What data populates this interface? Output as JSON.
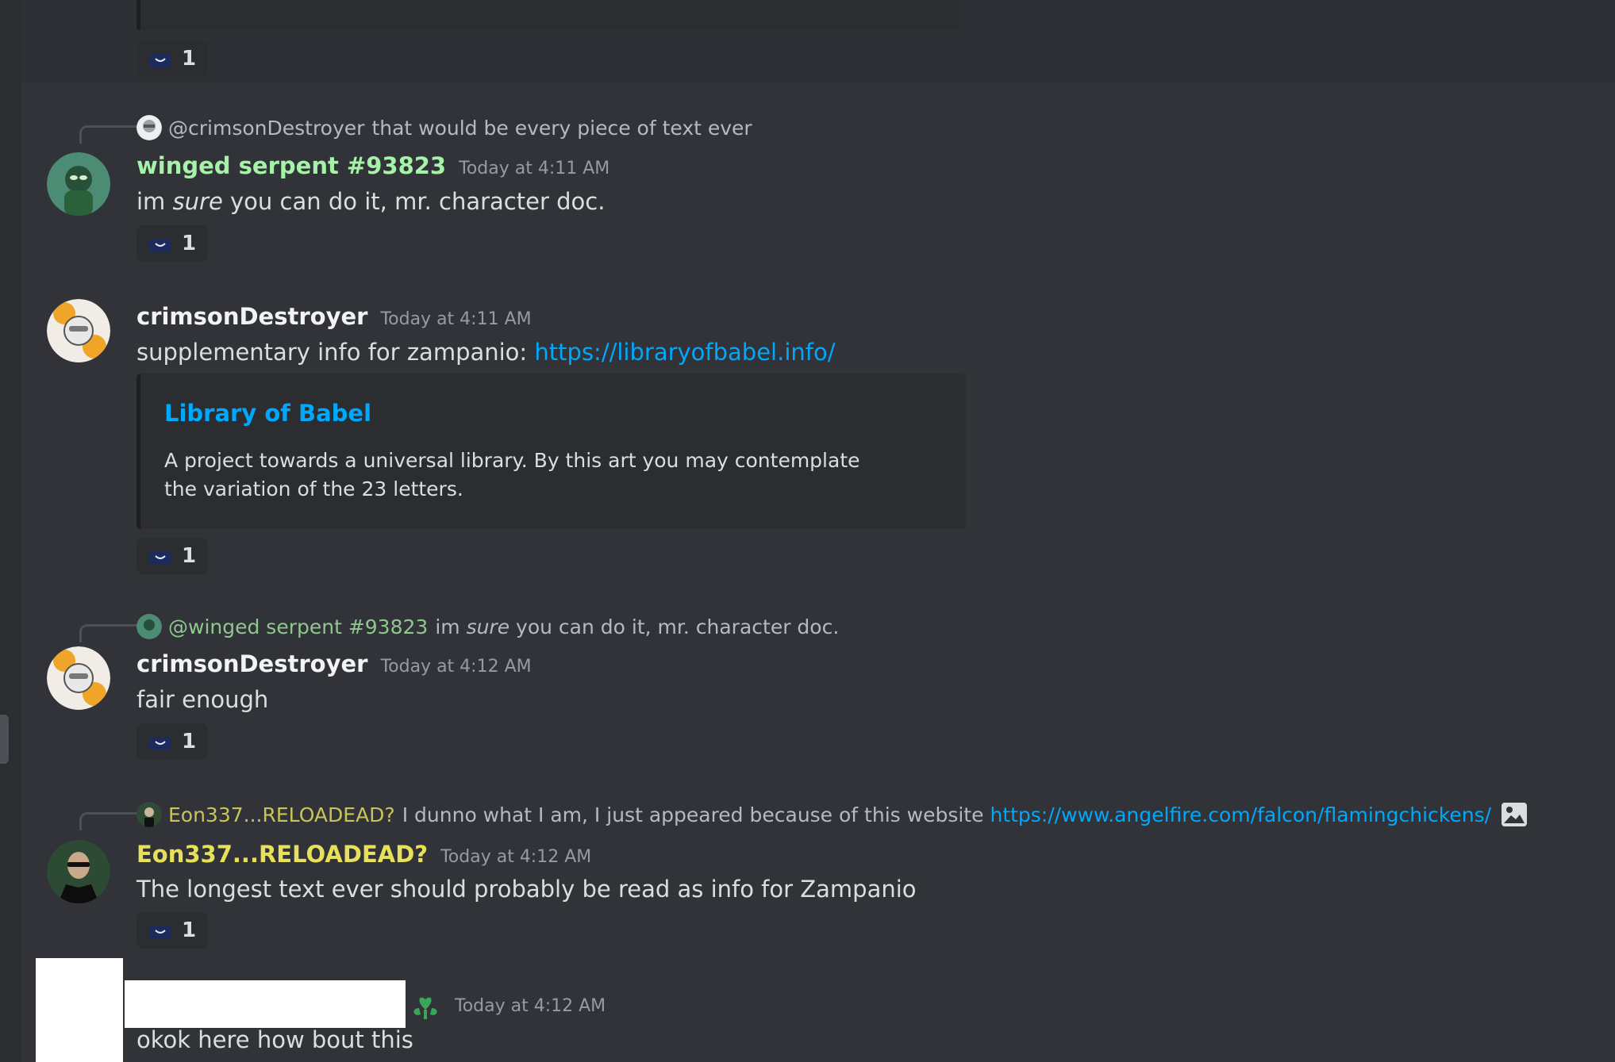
{
  "colors": {
    "background": "#313338",
    "green_user": "#a6f2a8",
    "crimson_user": "#f2f3f5",
    "eon_user": "#e6e05a",
    "link": "#00a8fc",
    "timestamp": "#949ba4",
    "reply_green": "#8fc78f"
  },
  "reaction_count": "1",
  "messages": {
    "m1": {
      "reply": {
        "name": "@crimsonDestroyer",
        "text": "that would be every piece of text ever"
      },
      "author": "winged serpent #93823",
      "timestamp": "Today at 4:11 AM",
      "text_pre": "im ",
      "text_em": "sure",
      "text_post": " you can do it, mr. character doc."
    },
    "m2": {
      "author": "crimsonDestroyer",
      "timestamp": "Today at 4:11 AM",
      "text": "supplementary info for zampanio: ",
      "link": "https://libraryofbabel.info/",
      "embed": {
        "title": "Library of Babel",
        "description": "A project towards a universal library. By this art you may contemplate the variation of the 23 letters."
      }
    },
    "m3": {
      "reply": {
        "name": "@winged serpent #93823",
        "text_pre": "im ",
        "text_em": "sure",
        "text_post": " you can do it, mr. character doc."
      },
      "author": "crimsonDestroyer",
      "timestamp": "Today at 4:12 AM",
      "text": "fair enough"
    },
    "m4": {
      "reply": {
        "name": "Eon337...RELOADEAD?",
        "text": "I dunno what I am, I just appeared because of this website",
        "link": "https://www.angelfire.com/falcon/flamingchickens/"
      },
      "author": "Eon337...RELOADEAD?",
      "timestamp": "Today at 4:12 AM",
      "text": "The longest text ever should probably be read as info for Zampanio"
    },
    "m5": {
      "timestamp": "Today at 4:12 AM",
      "text": "okok here how bout this"
    }
  }
}
